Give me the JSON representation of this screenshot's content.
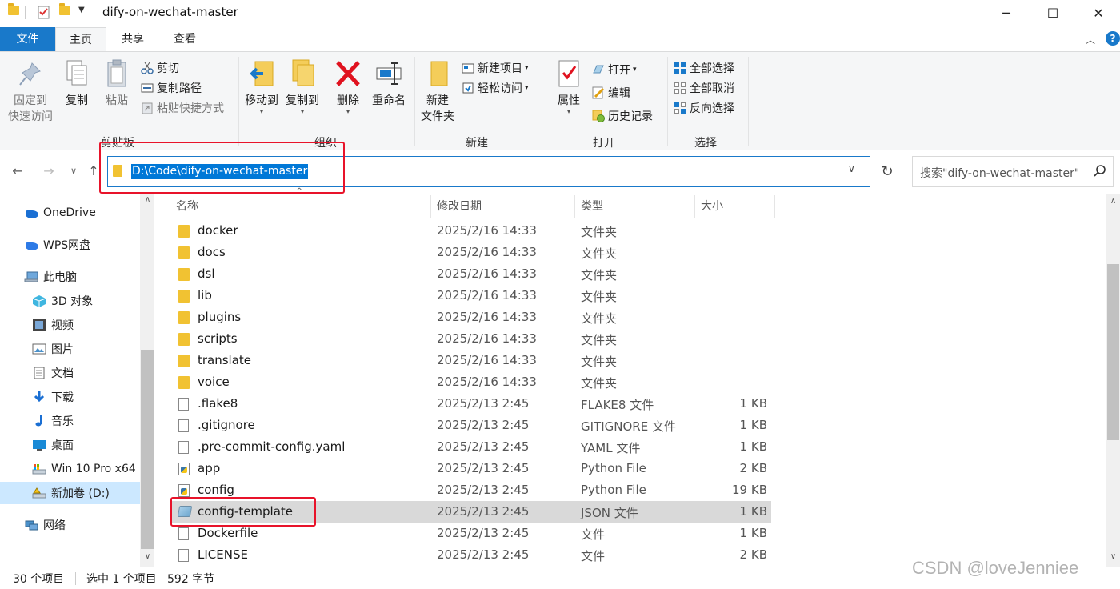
{
  "window": {
    "title": "dify-on-wechat-master",
    "minimize": "─",
    "maximize": "☐",
    "close": "✕"
  },
  "tabs": {
    "file": "文件",
    "home": "主页",
    "share": "共享",
    "view": "查看"
  },
  "ribbon": {
    "clipboard": {
      "label": "剪贴板",
      "pin": "固定到",
      "pin2": "快速访问",
      "copy": "复制",
      "paste": "粘贴",
      "cut": "剪切",
      "copy_path": "复制路径",
      "paste_shortcut": "粘贴快捷方式"
    },
    "organize": {
      "label": "组织",
      "move_to": "移动到",
      "copy_to": "复制到",
      "delete": "删除",
      "rename": "重命名"
    },
    "new": {
      "label": "新建",
      "new_folder": "新建",
      "new_folder2": "文件夹",
      "new_item": "新建项目",
      "easy_access": "轻松访问"
    },
    "open": {
      "label": "打开",
      "properties": "属性",
      "open": "打开",
      "edit": "编辑",
      "history": "历史记录"
    },
    "select": {
      "label": "选择",
      "select_all": "全部选择",
      "select_none": "全部取消",
      "invert": "反向选择"
    }
  },
  "address": {
    "path": "D:\\Code\\dify-on-wechat-master",
    "search_placeholder": "搜索\"dify-on-wechat-master\""
  },
  "nav": [
    {
      "label": "OneDrive",
      "icon": "cloud-icon"
    },
    {
      "label": "WPS网盘",
      "icon": "cloud-icon"
    },
    {
      "label": "此电脑",
      "icon": "computer-icon"
    },
    {
      "label": "3D 对象",
      "icon": "cube-icon"
    },
    {
      "label": "视频",
      "icon": "video-icon"
    },
    {
      "label": "图片",
      "icon": "picture-icon"
    },
    {
      "label": "文档",
      "icon": "document-icon"
    },
    {
      "label": "下载",
      "icon": "download-icon"
    },
    {
      "label": "音乐",
      "icon": "music-icon"
    },
    {
      "label": "桌面",
      "icon": "desktop-icon"
    },
    {
      "label": "Win 10 Pro x64",
      "icon": "drive-icon"
    },
    {
      "label": "新加卷 (D:)",
      "icon": "drive-icon"
    },
    {
      "label": "网络",
      "icon": "network-icon"
    }
  ],
  "columns": {
    "name": "名称",
    "date": "修改日期",
    "type": "类型",
    "size": "大小"
  },
  "files": [
    {
      "name": "docker",
      "date": "2025/2/16 14:33",
      "type": "文件夹",
      "size": "",
      "icon": "folder-icon"
    },
    {
      "name": "docs",
      "date": "2025/2/16 14:33",
      "type": "文件夹",
      "size": "",
      "icon": "folder-icon"
    },
    {
      "name": "dsl",
      "date": "2025/2/16 14:33",
      "type": "文件夹",
      "size": "",
      "icon": "folder-icon"
    },
    {
      "name": "lib",
      "date": "2025/2/16 14:33",
      "type": "文件夹",
      "size": "",
      "icon": "folder-icon"
    },
    {
      "name": "plugins",
      "date": "2025/2/16 14:33",
      "type": "文件夹",
      "size": "",
      "icon": "folder-icon"
    },
    {
      "name": "scripts",
      "date": "2025/2/16 14:33",
      "type": "文件夹",
      "size": "",
      "icon": "folder-icon"
    },
    {
      "name": "translate",
      "date": "2025/2/16 14:33",
      "type": "文件夹",
      "size": "",
      "icon": "folder-icon"
    },
    {
      "name": "voice",
      "date": "2025/2/16 14:33",
      "type": "文件夹",
      "size": "",
      "icon": "folder-icon"
    },
    {
      "name": ".flake8",
      "date": "2025/2/13 2:45",
      "type": "FLAKE8 文件",
      "size": "1 KB",
      "icon": "file-icon"
    },
    {
      "name": ".gitignore",
      "date": "2025/2/13 2:45",
      "type": "GITIGNORE 文件",
      "size": "1 KB",
      "icon": "file-icon"
    },
    {
      "name": ".pre-commit-config.yaml",
      "date": "2025/2/13 2:45",
      "type": "YAML 文件",
      "size": "1 KB",
      "icon": "file-icon"
    },
    {
      "name": "app",
      "date": "2025/2/13 2:45",
      "type": "Python File",
      "size": "2 KB",
      "icon": "python-icon"
    },
    {
      "name": "config",
      "date": "2025/2/13 2:45",
      "type": "Python File",
      "size": "19 KB",
      "icon": "python-icon"
    },
    {
      "name": "config-template",
      "date": "2025/2/13 2:45",
      "type": "JSON 文件",
      "size": "1 KB",
      "icon": "json-icon"
    },
    {
      "name": "Dockerfile",
      "date": "2025/2/13 2:45",
      "type": "文件",
      "size": "1 KB",
      "icon": "file-icon"
    },
    {
      "name": "LICENSE",
      "date": "2025/2/13 2:45",
      "type": "文件",
      "size": "2 KB",
      "icon": "file-icon"
    }
  ],
  "status": {
    "count": "30 个项目",
    "selected": "选中 1 个项目",
    "size": "592 字节"
  },
  "watermark": "CSDN @loveJenniee"
}
